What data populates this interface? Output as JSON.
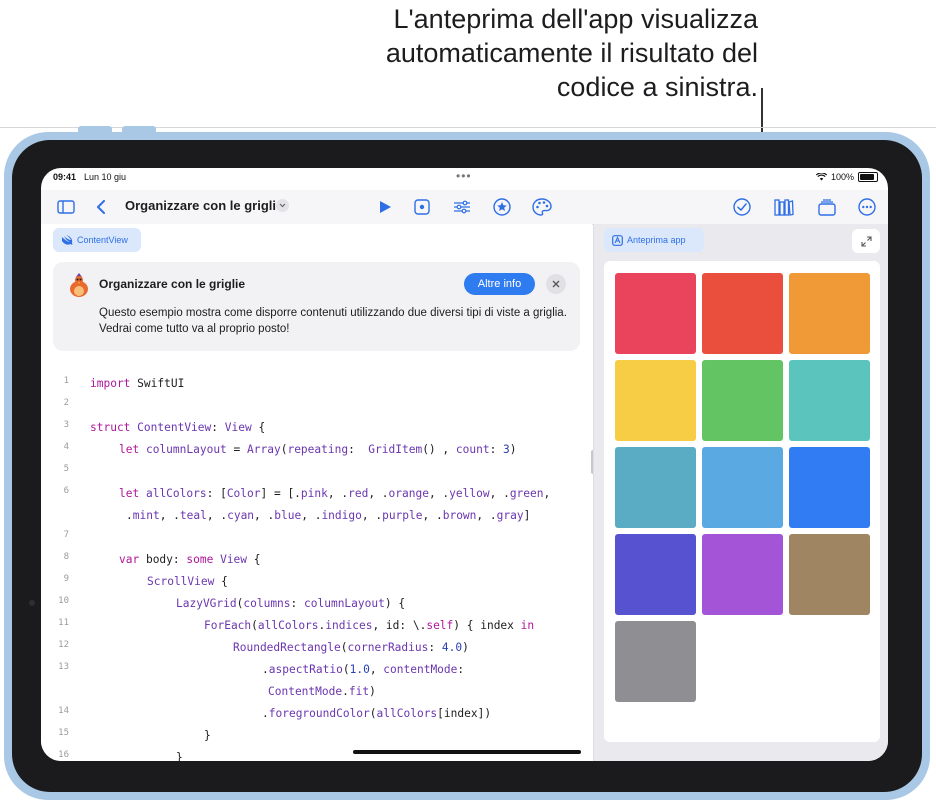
{
  "callout": {
    "line1": "L'anteprima dell'app visualizza",
    "line2": "automaticamente il risultato del",
    "line3": "codice a sinistra."
  },
  "status": {
    "time": "09:41",
    "date": "Lun 10 giu",
    "battery": "100%"
  },
  "toolbar": {
    "title": "Organizzare con le griglie",
    "icons": [
      "sidebar-icon",
      "back-chevron-icon",
      "run-icon",
      "step-icon",
      "sliders-icon",
      "star-icon",
      "palette-icon",
      "checkmark-icon",
      "library-icon",
      "windows-icon",
      "more-icon"
    ]
  },
  "editor": {
    "chip_label": "ContentView",
    "banner": {
      "title": "Organizzare con le griglie",
      "button": "Altre info",
      "body": "Questo esempio mostra come disporre contenuti utilizzando due diversi tipi di viste a griglia. Vedrai come tutto va al proprio posto!"
    },
    "line_numbers": [
      "1",
      "2",
      "3",
      "4",
      "5",
      "6",
      "7",
      "8",
      "9",
      "10",
      "11",
      "12",
      "13",
      "14",
      "15",
      "16"
    ]
  },
  "preview": {
    "chip_label": "Anteprima app",
    "tiles": [
      {
        "name": "pink",
        "color": "#e9445b"
      },
      {
        "name": "red",
        "color": "#ea4e3d"
      },
      {
        "name": "orange",
        "color": "#f09a37"
      },
      {
        "name": "yellow",
        "color": "#f6cd45"
      },
      {
        "name": "green",
        "color": "#62c462"
      },
      {
        "name": "mint",
        "color": "#5bc4bd"
      },
      {
        "name": "teal",
        "color": "#5aacc5"
      },
      {
        "name": "cyan",
        "color": "#5ba9e3"
      },
      {
        "name": "blue",
        "color": "#327cf3"
      },
      {
        "name": "indigo",
        "color": "#5752cf"
      },
      {
        "name": "purple",
        "color": "#a455d7"
      },
      {
        "name": "brown",
        "color": "#a08563"
      },
      {
        "name": "gray",
        "color": "#8e8e93"
      }
    ]
  },
  "colors": {
    "accent": "#2f6fe6",
    "keyword": "#b0169a",
    "type": "#6b36b0",
    "number": "#2a3fb5"
  }
}
